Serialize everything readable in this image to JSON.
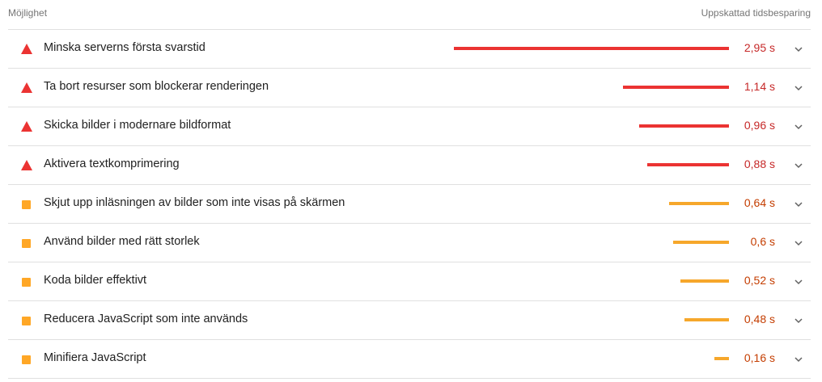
{
  "header": {
    "left_label": "Möjlighet",
    "right_label": "Uppskattad tidsbesparing"
  },
  "colors": {
    "fail": "#eb3332",
    "average": "#ffa726"
  },
  "opportunities": [
    {
      "title": "Minska serverns första svarstid",
      "value": "2,95 s",
      "seconds": 2.95,
      "severity": "fail",
      "icon": "triangle-warning-icon"
    },
    {
      "title": "Ta bort resurser som blockerar renderingen",
      "value": "1,14 s",
      "seconds": 1.14,
      "severity": "fail",
      "icon": "triangle-warning-icon"
    },
    {
      "title": "Skicka bilder i modernare bildformat",
      "value": "0,96 s",
      "seconds": 0.96,
      "severity": "fail",
      "icon": "triangle-warning-icon"
    },
    {
      "title": "Aktivera textkomprimering",
      "value": "0,88 s",
      "seconds": 0.88,
      "severity": "fail",
      "icon": "triangle-warning-icon"
    },
    {
      "title": "Skjut upp inläsningen av bilder som inte visas på skärmen",
      "value": "0,64 s",
      "seconds": 0.64,
      "severity": "average",
      "icon": "square-average-icon"
    },
    {
      "title": "Använd bilder med rätt storlek",
      "value": "0,6 s",
      "seconds": 0.6,
      "severity": "average",
      "icon": "square-average-icon"
    },
    {
      "title": "Koda bilder effektivt",
      "value": "0,52 s",
      "seconds": 0.52,
      "severity": "average",
      "icon": "square-average-icon"
    },
    {
      "title": "Reducera JavaScript som inte används",
      "value": "0,48 s",
      "seconds": 0.48,
      "severity": "average",
      "icon": "square-average-icon"
    },
    {
      "title": "Minifiera JavaScript",
      "value": "0,16 s",
      "seconds": 0.16,
      "severity": "average",
      "icon": "square-average-icon"
    }
  ]
}
